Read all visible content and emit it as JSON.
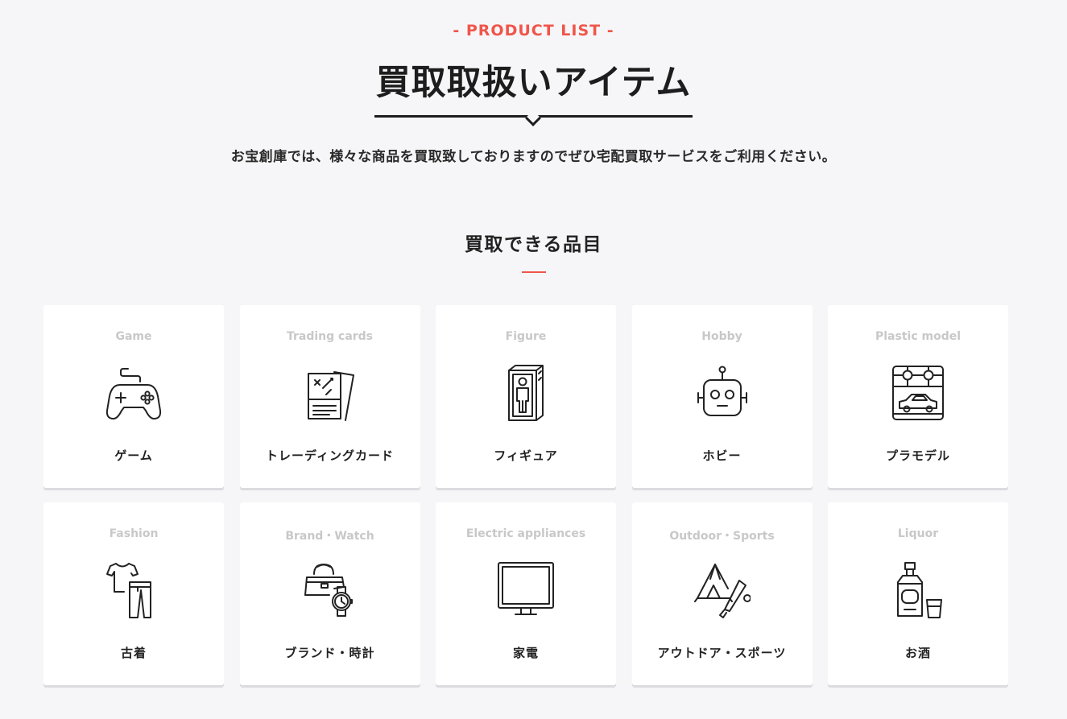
{
  "header": {
    "eyebrow": "- PRODUCT LIST -",
    "title": "買取取扱いアイテム",
    "lead": "お宝創庫では、様々な商品を買取致しておりますのでぜひ宅配買取サービスをご利用ください。"
  },
  "section": {
    "title": "買取できる品目"
  },
  "accent_color": "#f0554a",
  "categories": [
    {
      "en": "Game",
      "jp": "ゲーム",
      "icon": "game-controller-icon"
    },
    {
      "en": "Trading cards",
      "jp": "トレーディングカード",
      "icon": "trading-cards-icon"
    },
    {
      "en": "Figure",
      "jp": "フィギュア",
      "icon": "figure-box-icon"
    },
    {
      "en": "Hobby",
      "jp": "ホビー",
      "icon": "robot-icon"
    },
    {
      "en": "Plastic model",
      "jp": "プラモデル",
      "icon": "plastic-model-icon"
    },
    {
      "en": "Fashion",
      "jp": "古着",
      "icon": "clothing-icon"
    },
    {
      "en": "Brand・Watch",
      "jp": "ブランド・時計",
      "icon": "bag-watch-icon"
    },
    {
      "en": "Electric appliances",
      "jp": "家電",
      "icon": "monitor-icon"
    },
    {
      "en": "Outdoor・Sports",
      "jp": "アウトドア・スポーツ",
      "icon": "tent-bat-icon"
    },
    {
      "en": "Liquor",
      "jp": "お酒",
      "icon": "liquor-bottle-icon"
    }
  ]
}
